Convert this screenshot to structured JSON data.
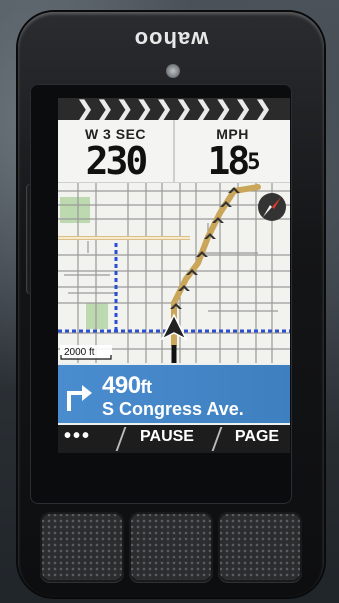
{
  "device": {
    "logo": "wahoo"
  },
  "header_chevrons": [
    "❯",
    "❯",
    "❯",
    "❯",
    "❯",
    "❯",
    "❯",
    "❯",
    "❯",
    "❯"
  ],
  "metrics": [
    {
      "label": "W 3 SEC",
      "value": "230",
      "superscript": ""
    },
    {
      "label": "MPH",
      "value": "18",
      "superscript": "5"
    }
  ],
  "map": {
    "scale_label": "2000 ft",
    "compass_icon": "compass-icon",
    "route_color": "#c9a65a",
    "boundary_color": "#2b4fd1"
  },
  "navigation": {
    "turn_icon": "turn-right-icon",
    "distance": "490",
    "unit": "ft",
    "street": "S Congress Ave.",
    "color": "#4a8dcf"
  },
  "bottom_bar": {
    "menu_label": "•••",
    "pause_label": "PAUSE",
    "page_label": "PAGE"
  }
}
